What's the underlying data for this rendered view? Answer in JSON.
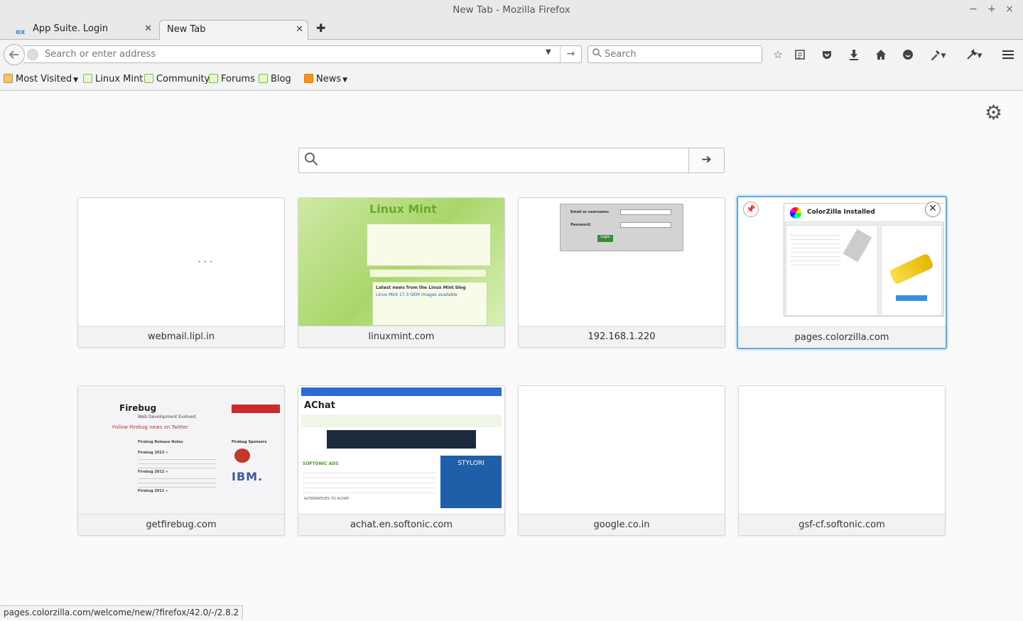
{
  "window": {
    "title": "New Tab - Mozilla Firefox",
    "controls": [
      "−",
      "+",
      "×"
    ]
  },
  "tabs": [
    {
      "label": "App Suite. Login",
      "icon": "ox-logo",
      "active": false
    },
    {
      "label": "New Tab",
      "active": true
    }
  ],
  "navbar": {
    "url_value": "",
    "url_placeholder": "Search or enter address",
    "search_placeholder": "Search"
  },
  "bookmarks": [
    {
      "label": "Most Visited",
      "icon": "folder",
      "dropdown": true
    },
    {
      "label": "Linux Mint",
      "icon": "mint"
    },
    {
      "label": "Community",
      "icon": "mint"
    },
    {
      "label": "Forums",
      "icon": "mint"
    },
    {
      "label": "Blog",
      "icon": "mint"
    },
    {
      "label": "News",
      "icon": "rss",
      "dropdown": true
    }
  ],
  "newtab": {
    "search_value": "",
    "tiles": [
      {
        "label": "webmail.lipl.in"
      },
      {
        "label": "linuxmint.com"
      },
      {
        "label": "192.168.1.220"
      },
      {
        "label": "pages.colorzilla.com",
        "highlighted": true
      },
      {
        "label": "getfirebug.com"
      },
      {
        "label": "achat.en.softonic.com"
      },
      {
        "label": "google.co.in"
      },
      {
        "label": "gsf-cf.softonic.com"
      }
    ],
    "thumb_text": {
      "mint_logo": "Linux Mint",
      "mint_news_title": "Latest news from the Linux Mint blog",
      "mint_news_sub": "Linux Mint 17.3 OEM images available",
      "ip_user": "Email or username:",
      "ip_pass": "Password:",
      "ip_login": "Login",
      "cz_title": "ColorZilla Installed",
      "fb_title": "Firebug",
      "fb_tagline": "Web Development Evolved.",
      "fb_twitter": "Follow Firebug news on Twitter",
      "fb_release": "Firebug Release Notes",
      "fb_2013": "Firebug 2013 »",
      "fb_2012": "Firebug 2012 »",
      "fb_2011": "Firebug 2011 »",
      "fb_sponsors": "Firebug Sponsors",
      "fb_ibm": "IBM.",
      "sf_title": "AChat",
      "sf_ads": "SOFTONIC ADS",
      "sf_stylori": "STYLORI",
      "sf_alternatives": "ALTERNATIVES TO ACHAT:"
    }
  },
  "status": {
    "text": "pages.colorzilla.com/welcome/new/?firefox/42.0/-/2.8.2"
  }
}
